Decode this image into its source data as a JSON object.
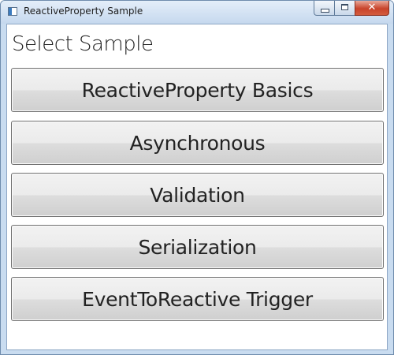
{
  "window": {
    "title": "ReactiveProperty Sample",
    "icon": "window-app-icon",
    "caption_buttons": [
      "minimize",
      "maximize",
      "close"
    ],
    "close_glyph": "✕"
  },
  "main": {
    "heading": "Select Sample",
    "samples": [
      {
        "label": "ReactiveProperty Basics"
      },
      {
        "label": "Asynchronous"
      },
      {
        "label": "Validation"
      },
      {
        "label": "Serialization"
      },
      {
        "label": "EventToReactive Trigger"
      }
    ]
  },
  "colors": {
    "titlebar": "#c5d8ee",
    "close_button": "#c8442b",
    "button_face": "#e5e5e5",
    "button_border": "#707070"
  }
}
